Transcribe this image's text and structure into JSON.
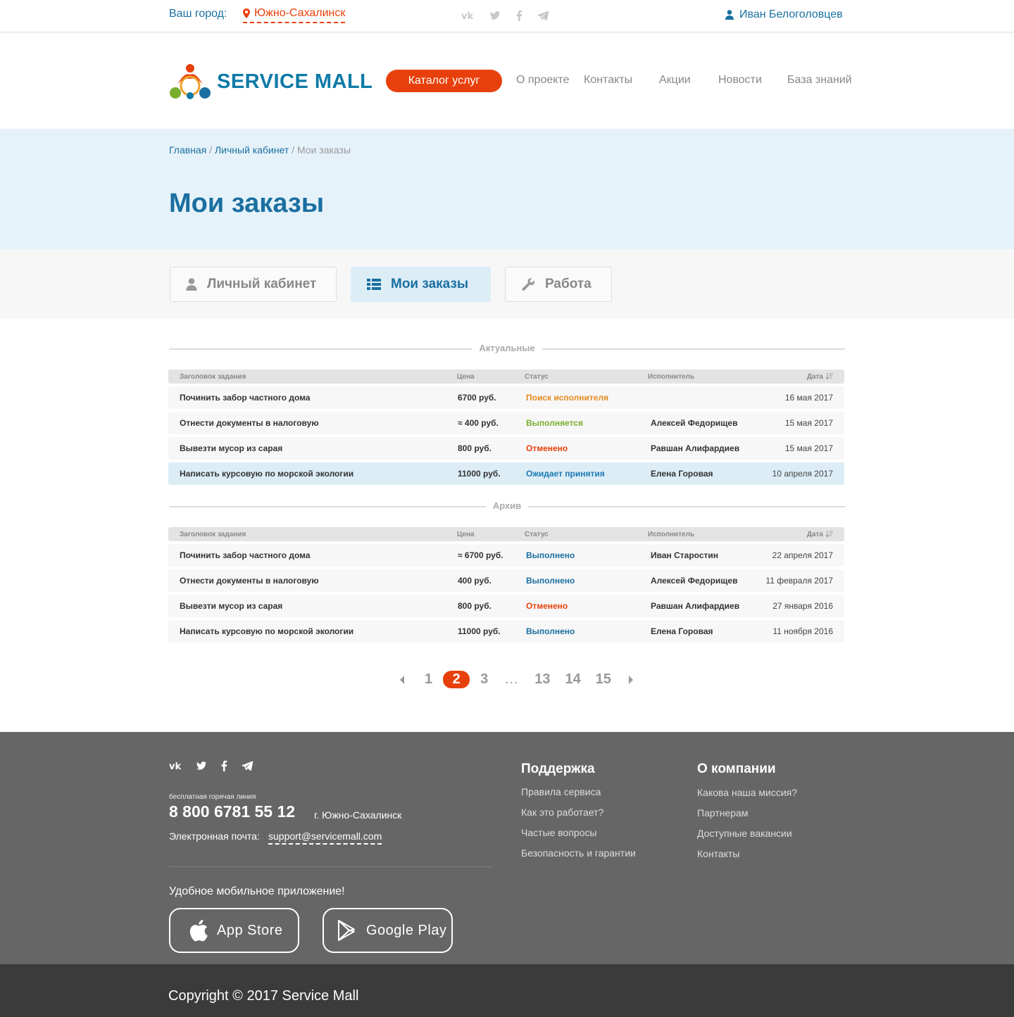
{
  "topbar": {
    "city_label": "Ваш город:",
    "city": "Южно-Сахалинск",
    "social_icons": [
      "vk-icon",
      "twitter-icon",
      "facebook-icon",
      "telegram-icon"
    ],
    "user_name": "Иван Белоголовцев"
  },
  "header": {
    "logo_text": "SERVICE MALL",
    "catalog_button": "Каталог услуг",
    "nav": [
      "О проекте",
      "Контакты",
      "Акции",
      "Новости",
      "База знаний"
    ]
  },
  "hero": {
    "breadcrumb": {
      "home": "Главная",
      "cabinet": "Личный кабинет",
      "current": "Мои заказы",
      "separator": "/"
    },
    "title": "Мои заказы"
  },
  "tabs": [
    {
      "label": "Личный кабинет",
      "icon": "user-icon"
    },
    {
      "label": "Мои заказы",
      "icon": "list-icon",
      "active": true
    },
    {
      "label": "Работа",
      "icon": "wrench-icon"
    }
  ],
  "columns": {
    "title": "Заголовок задания",
    "price": "Цена",
    "status": "Статус",
    "executor": "Исполнитель",
    "date": "Дата"
  },
  "sections": {
    "actual": {
      "label": "Актуальные",
      "rows": [
        {
          "title": "Починить забор частного дома",
          "price": "6700 руб.",
          "status": "Поиск исполнителя",
          "status_type": "search",
          "executor": "",
          "date": "16 мая 2017"
        },
        {
          "title": "Отнести документы в налоговую",
          "price": "≈ 400 руб.",
          "status": "Выполняется",
          "status_type": "progress",
          "executor": "Алексей Федорищев",
          "date": "15 мая 2017"
        },
        {
          "title": "Вывезти мусор из сарая",
          "price": "800 руб.",
          "status": "Отменено",
          "status_type": "cancel",
          "executor": "Равшан Алифардиев",
          "date": "15 мая 2017"
        },
        {
          "title": "Написать курсовую по морской экологии",
          "price": "11000 руб.",
          "status": "Ожидает принятия",
          "status_type": "wait",
          "executor": "Елена Горовая",
          "date": "10 апреля 2017"
        }
      ]
    },
    "archive": {
      "label": "Архив",
      "rows": [
        {
          "title": "Починить забор частного дома",
          "price": "≈ 6700 руб.",
          "status": "Выполнено",
          "status_type": "done",
          "executor": "Иван Старостин",
          "date": "22 апреля 2017"
        },
        {
          "title": "Отнести документы в налоговую",
          "price": "400 руб.",
          "status": "Выполнено",
          "status_type": "done",
          "executor": "Алексей Федорищев",
          "date": "11 февраля 2017"
        },
        {
          "title": "Вывезти мусор из сарая",
          "price": "800 руб.",
          "status": "Отменено",
          "status_type": "cancel",
          "executor": "Равшан Алифардиев",
          "date": "27 января 2016"
        },
        {
          "title": "Написать курсовую по морской экологии",
          "price": "11000 руб.",
          "status": "Выполнено",
          "status_type": "done",
          "executor": "Елена Горовая",
          "date": "11 ноября 2016"
        }
      ]
    }
  },
  "pagination": {
    "pages": [
      "1",
      "2",
      "3",
      "…",
      "13",
      "14",
      "15"
    ],
    "current": "2"
  },
  "footer": {
    "hotline_label": "бесплатная горячая линия",
    "phone": "8 800 6781 55 12",
    "city": "г. Южно-Сахалинск",
    "email_label": "Электронная почта:",
    "email": "support@servicemall.com",
    "app_label": "Удобное мобильное приложение!",
    "app_store": "App Store",
    "google_play": "Google Play",
    "support": {
      "title": "Поддержка",
      "links": [
        "Правила сервиса",
        "Как это работает?",
        "Частые вопросы",
        "Безопасность и гарантии"
      ]
    },
    "company": {
      "title": "О компании",
      "links": [
        "Какова наша миссия?",
        "Партнерам",
        "Доступные вакансии",
        "Контакты"
      ]
    },
    "copyright": "Copyright © 2017 Service Mall"
  },
  "colors": {
    "accent": "#e8400c",
    "brand": "#1a6fa0",
    "hero_bg": "#e6f2f9",
    "footer_bg": "#666666",
    "copyright_bg": "#3b3b3b"
  }
}
